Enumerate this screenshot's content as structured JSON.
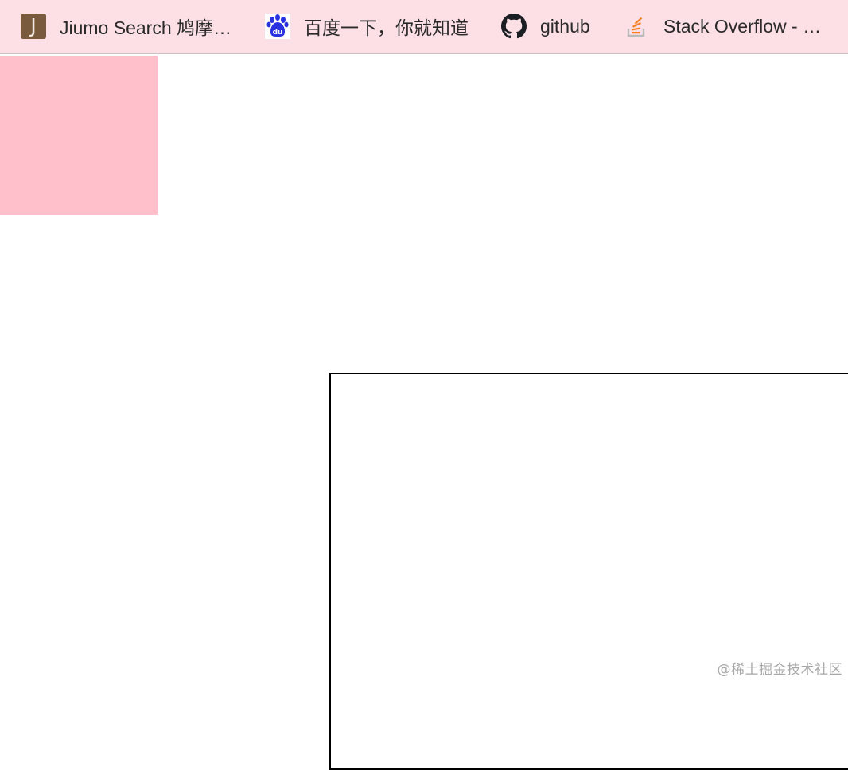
{
  "bookmarks": [
    {
      "label": "Jiumo Search 鸠摩搜书",
      "icon": "jiumo-j-favicon",
      "icon_letter": "J"
    },
    {
      "label": "百度一下，你就知道",
      "icon": "baidu-paw-favicon",
      "icon_text": "du"
    },
    {
      "label": "github",
      "icon": "github-octocat-favicon"
    },
    {
      "label": "Stack Overflow - Where Developers Learn",
      "icon": "stackoverflow-favicon"
    }
  ],
  "colors": {
    "bookmarks_bar_bg": "#fde0e5",
    "pink_box": "#ffc0cb",
    "outline": "#000000",
    "baidu_blue": "#2932e1",
    "stackoverflow_orange": "#f48024"
  },
  "watermark": "@稀土掘金技术社区"
}
